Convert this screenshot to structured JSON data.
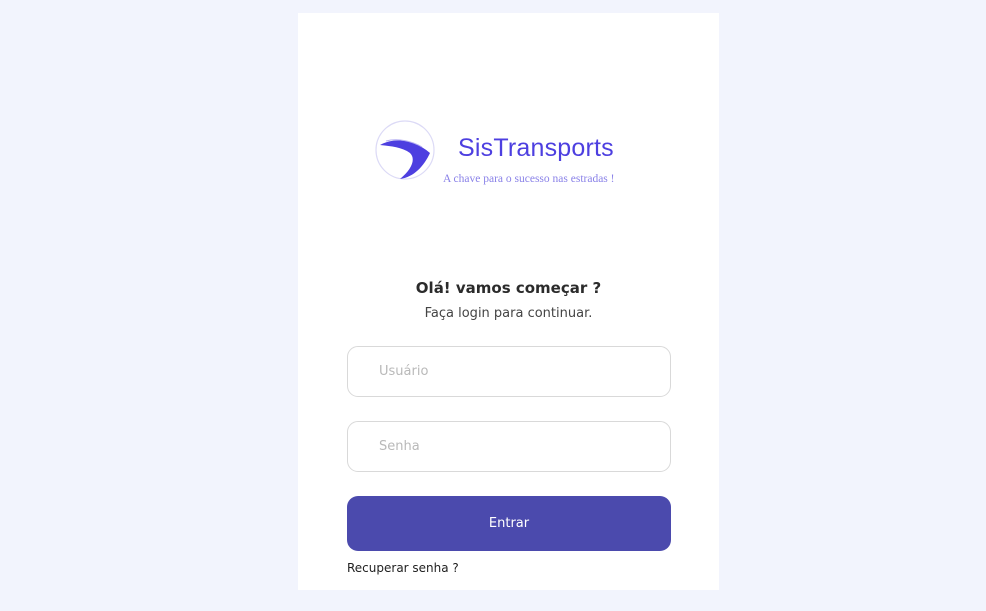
{
  "brand": {
    "name": "SisTransports",
    "tagline": "A chave para o sucesso nas estradas !",
    "logo_icon": "road-logo-icon",
    "color": "#4d3fe0"
  },
  "login": {
    "greeting": "Olá! vamos começar ?",
    "subtitle": "Faça login para continuar.",
    "username_placeholder": "Usuário",
    "username_value": "",
    "password_placeholder": "Senha",
    "password_value": "",
    "submit_label": "Entrar",
    "recover_label": "Recuperar senha ?"
  },
  "colors": {
    "background": "#f2f4fd",
    "card": "#ffffff",
    "button": "#4b4aad"
  }
}
